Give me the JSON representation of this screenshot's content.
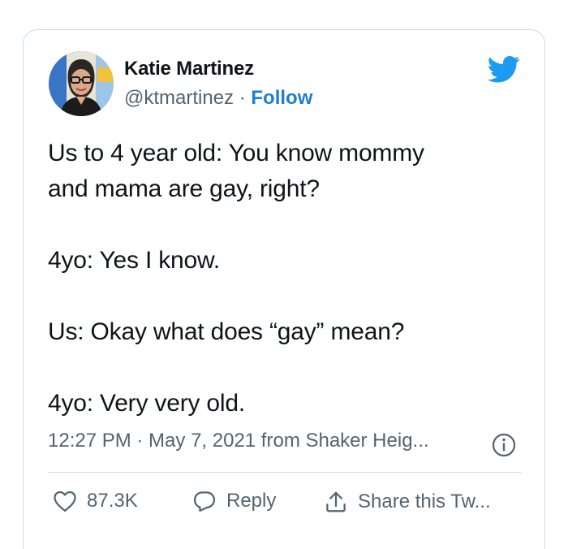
{
  "author": {
    "name": "Katie Martinez",
    "handle": "@ktmartinez",
    "separator": " · ",
    "follow_label": "Follow"
  },
  "tweet": {
    "text": "Us to 4 year old: You know mommy\nand mama are gay, right?\n\n4yo: Yes I know.\n\nUs: Okay what does “gay” mean?\n\n4yo: Very very old.",
    "meta": "12:27 PM · May 7, 2021 from Shaker Heig..."
  },
  "actions": {
    "like_count": "87.3K",
    "reply_label": "Reply",
    "share_label": "Share this Tw..."
  },
  "colors": {
    "brand": "#1d9bf0",
    "follow": "#1d7fd0",
    "muted_text": "#536471",
    "border": "#cfd9de"
  },
  "icons": [
    "twitter-bird-icon",
    "info-icon",
    "heart-icon",
    "reply-bubble-icon",
    "share-upload-icon"
  ]
}
